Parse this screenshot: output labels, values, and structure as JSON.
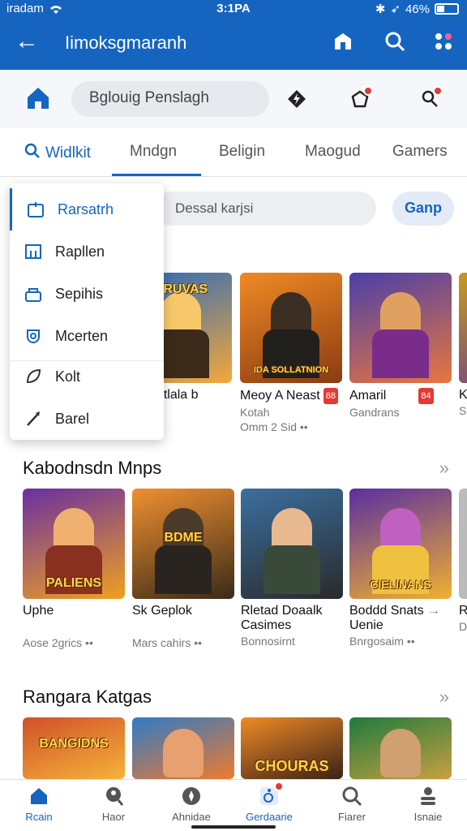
{
  "status": {
    "carrier": "iradam",
    "time": "3:1PA",
    "battery": "46%"
  },
  "appbar": {
    "title": "Iimoksgmaranh"
  },
  "search": {
    "placeholder": "Bglouig Penslagh"
  },
  "tabs": [
    {
      "label": "Widlkit",
      "active": true
    },
    {
      "label": "Mndgn"
    },
    {
      "label": "Beligin"
    },
    {
      "label": "Maogud"
    },
    {
      "label": "Gamers"
    }
  ],
  "filter": {
    "placeholder": "Dessal karjsi",
    "button_label": "Ganp"
  },
  "menu": {
    "items": [
      {
        "label": "Rarsatrh",
        "icon": "calendar-icon"
      },
      {
        "label": "Rapllen",
        "icon": "layout-icon"
      },
      {
        "label": "Sepihis",
        "icon": "lock-icon"
      },
      {
        "label": "Mcerten",
        "icon": "shield-icon"
      },
      {
        "label": "Kolt",
        "icon": "leaf-icon"
      },
      {
        "label": "Barel",
        "icon": "brush-icon"
      }
    ]
  },
  "row1": {
    "cards": [
      {
        "title": "Saotetlala b",
        "sub": "Ana",
        "art": "DRUVAS",
        "c1": "#2e6bb8",
        "c2": "#f4a83a"
      },
      {
        "title": "Meoy A Neast",
        "badge": "88",
        "sub1": "Kotah",
        "sub": "Omm 2 Sid",
        "art": "IDA SOLLATNION",
        "c1": "#8a3b12",
        "c2": "#f08a24"
      },
      {
        "title": "Amaril",
        "badge": "84",
        "sub": "Gandrans",
        "art": "",
        "c1": "#4a3fa8",
        "c2": "#e9763f"
      },
      {
        "title": "K",
        "sub": "S",
        "art": "",
        "c1": "#c89a1e",
        "c2": "#6b3d8c"
      }
    ]
  },
  "section1": {
    "title": "Kabodnsdn Mnps"
  },
  "row2": {
    "cards": [
      {
        "title": "Uphe",
        "sub": "Aose 2grics",
        "art": "PALIENS",
        "c1": "#6a2fa0",
        "c2": "#f0a020"
      },
      {
        "title": "Sk Geplok",
        "sub": "Mars cahirs",
        "art": "BDME",
        "c1": "#f09030",
        "c2": "#3a2a18"
      },
      {
        "title": "Rletad Doaalk Casimes",
        "sub": "Bonnosirnt",
        "art": "",
        "c1": "#3b6fa0",
        "c2": "#2a2a2a"
      },
      {
        "title": "Boddd Snats",
        "title2": "Uenie",
        "sub": "Bnrgosaim",
        "art": "CIELINANS",
        "c1": "#5a2ea0",
        "c2": "#f0b030"
      },
      {
        "title": "R",
        "sub": "D",
        "art": "",
        "c1": "#777777",
        "c2": "#bbbbbb"
      }
    ]
  },
  "section2": {
    "title": "Rangara Katgas"
  },
  "row3": {
    "cards": [
      {
        "art": "BANGIDNS",
        "c1": "#d0502a",
        "c2": "#f6b33a"
      },
      {
        "art": "",
        "c1": "#2e7bc4",
        "c2": "#f07a30"
      },
      {
        "art": "CHOURAS",
        "c1": "#f08a24",
        "c2": "#3a2218"
      },
      {
        "art": "",
        "c1": "#1f7a3e",
        "c2": "#c8a040"
      }
    ]
  },
  "nav": [
    {
      "label": "Rcain",
      "icon": "home-icon",
      "active": true
    },
    {
      "label": "Haor",
      "icon": "search-person-icon"
    },
    {
      "label": "Ahnidae",
      "icon": "compass-icon"
    },
    {
      "label": "Gerdaarie",
      "icon": "wheelchair-icon",
      "badge": true
    },
    {
      "label": "Fiarer",
      "icon": "search-icon"
    },
    {
      "label": "Isnaie",
      "icon": "stack-icon"
    }
  ],
  "colors": {
    "primary": "#1565c0",
    "badge": "#e53935"
  }
}
